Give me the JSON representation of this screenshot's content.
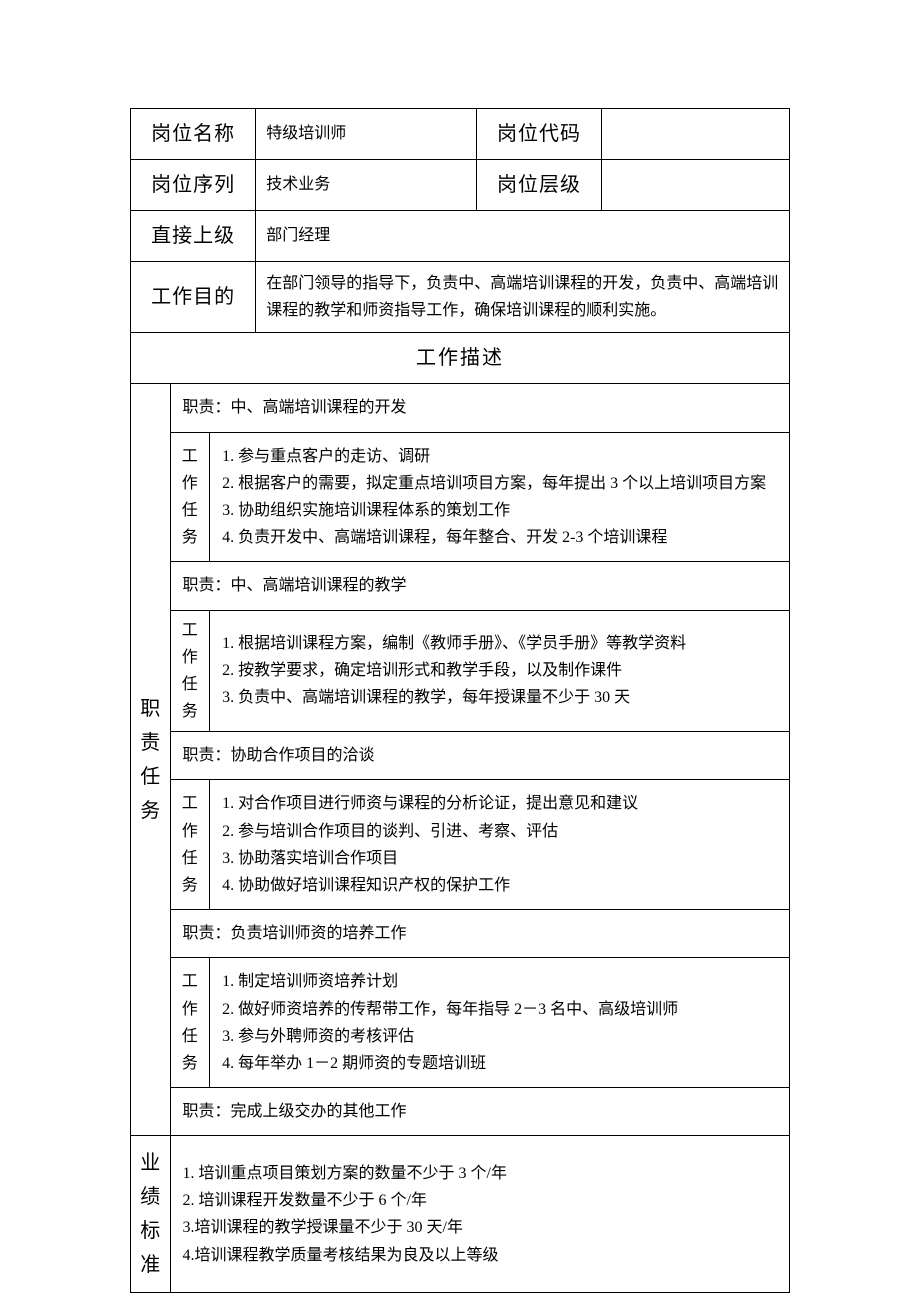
{
  "header": {
    "position_name_label": "岗位名称",
    "position_name_value": "特级培训师",
    "position_code_label": "岗位代码",
    "position_code_value": "",
    "position_series_label": "岗位序列",
    "position_series_value": "技术业务",
    "position_level_label": "岗位层级",
    "position_level_value": "",
    "direct_superior_label": "直接上级",
    "direct_superior_value": "部门经理",
    "work_purpose_label": "工作目的",
    "work_purpose_value": "在部门领导的指导下，负责中、高端培训课程的开发，负责中、高端培训课程的教学和师资指导工作，确保培训课程的顺利实施。"
  },
  "work_description_title": "工作描述",
  "duties_label": "职责任务",
  "task_label": "工作任务",
  "duties": [
    {
      "title": "职责：中、高端培训课程的开发",
      "tasks": [
        "1. 参与重点客户的走访、调研",
        "2. 根据客户的需要，拟定重点培训项目方案，每年提出 3 个以上培训项目方案",
        "3. 协助组织实施培训课程体系的策划工作",
        "4. 负责开发中、高端培训课程，每年整合、开发 2-3 个培训课程"
      ]
    },
    {
      "title": "职责：中、高端培训课程的教学",
      "tasks": [
        "1. 根据培训课程方案，编制《教师手册》、《学员手册》等教学资料",
        "2. 按教学要求，确定培训形式和教学手段，以及制作课件",
        "3. 负责中、高端培训课程的教学，每年授课量不少于 30 天"
      ]
    },
    {
      "title": "职责：协助合作项目的洽谈",
      "tasks": [
        "1. 对合作项目进行师资与课程的分析论证，提出意见和建议",
        "2. 参与培训合作项目的谈判、引进、考察、评估",
        "3. 协助落实培训合作项目",
        "4. 协助做好培训课程知识产权的保护工作"
      ]
    },
    {
      "title": "职责：负责培训师资的培养工作",
      "tasks": [
        "1. 制定培训师资培养计划",
        "2. 做好师资培养的传帮带工作，每年指导 2－3 名中、高级培训师",
        "3. 参与外聘师资的考核评估",
        "4. 每年举办 1－2 期师资的专题培训班"
      ]
    },
    {
      "title": "职责：完成上级交办的其他工作",
      "tasks": null
    }
  ],
  "performance_label": "业绩标准",
  "performance": [
    "1. 培训重点项目策划方案的数量不少于 3 个/年",
    "2. 培训课程开发数量不少于 6 个/年",
    "3.培训课程的教学授课量不少于 30 天/年",
    "4.培训课程教学质量考核结果为良及以上等级"
  ]
}
